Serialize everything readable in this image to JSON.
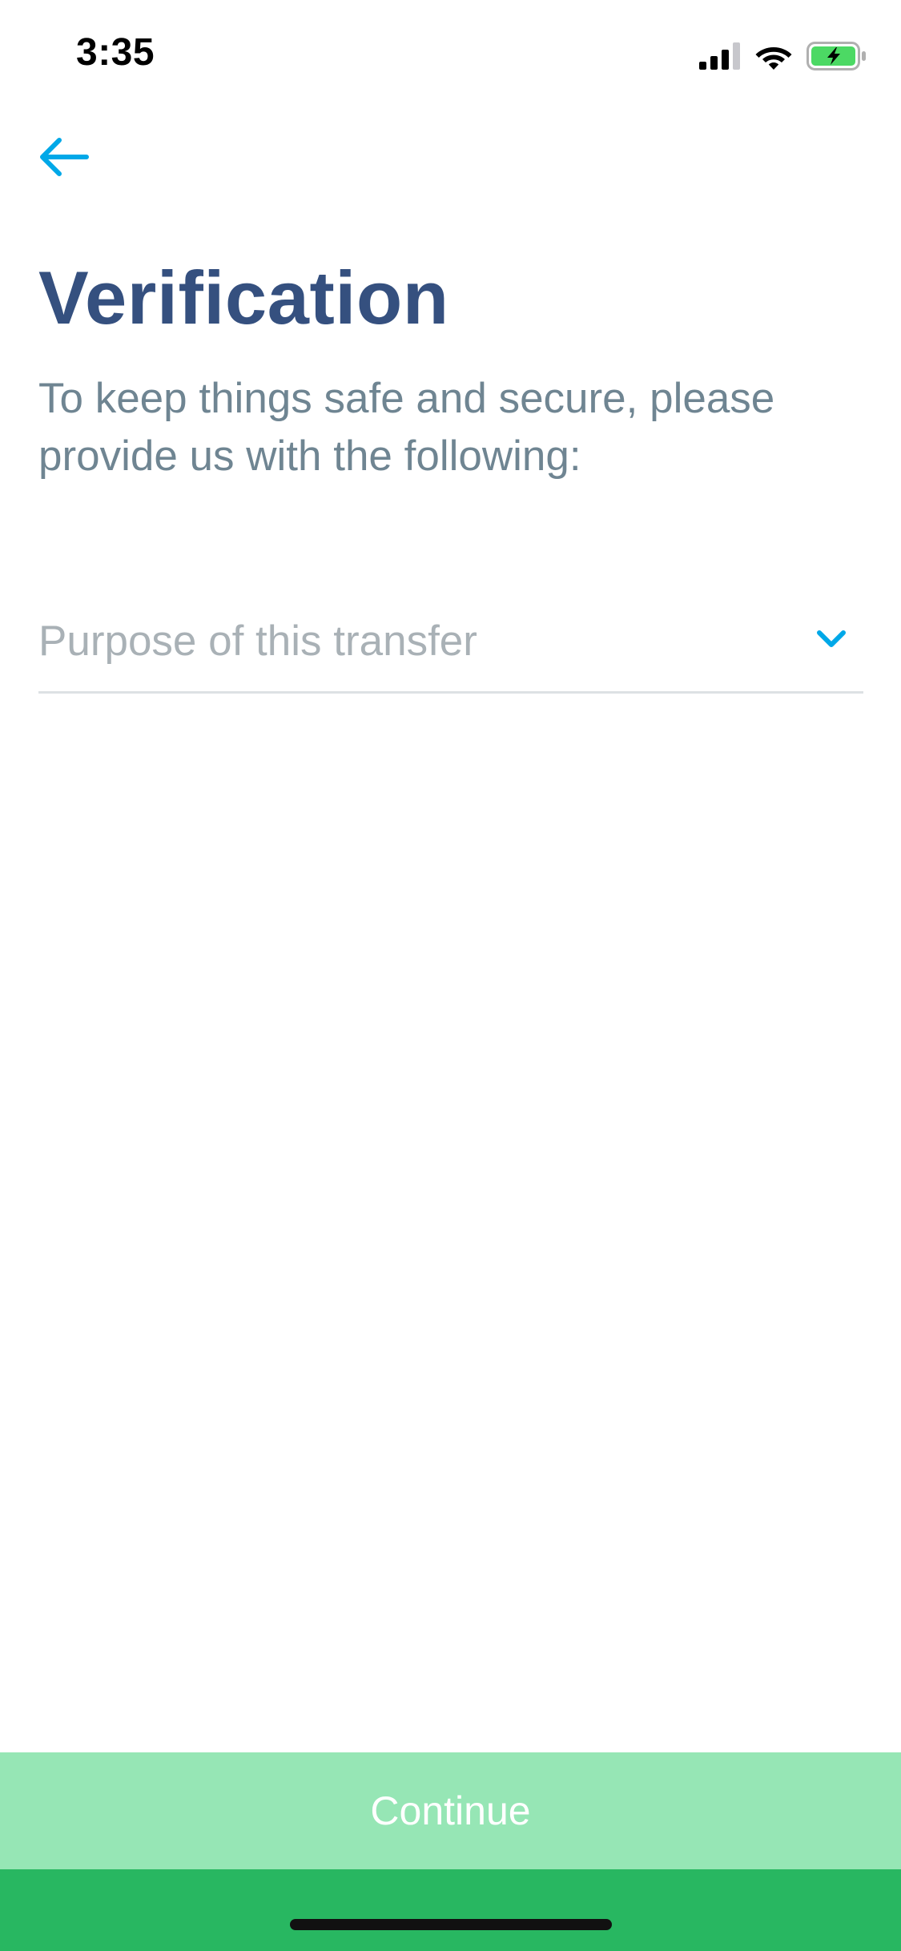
{
  "status_bar": {
    "time": "3:35",
    "icons": [
      "signal-icon",
      "wifi-icon",
      "battery-charging-icon"
    ],
    "battery_color": "#4cd964"
  },
  "header": {
    "back_icon": "arrow-left-icon",
    "accent_color": "#00a8e8"
  },
  "main": {
    "title": "Verification",
    "subtitle": "To keep things safe and secure, please provide us with the following:",
    "purpose_field": {
      "placeholder": "Purpose of this transfer",
      "value": "",
      "icon": "chevron-down-icon"
    }
  },
  "footer": {
    "continue_label": "Continue",
    "button_color": "#96e6b5",
    "strip_color": "#28b761"
  }
}
